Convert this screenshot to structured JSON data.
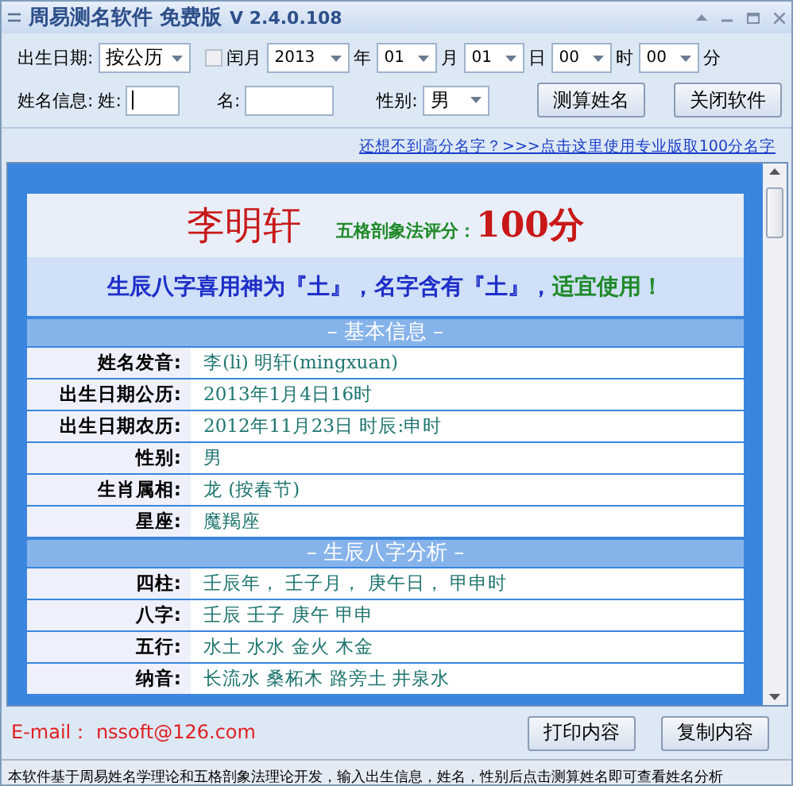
{
  "window": {
    "title": "周易测名软件 免费版",
    "version": "V 2.4.0.108"
  },
  "form": {
    "birth_label": "出生日期:",
    "calendar": "按公历",
    "leap_month": {
      "label": "闰月",
      "checked": false
    },
    "date_parts": [
      {
        "value": "2013",
        "unit": "年"
      },
      {
        "value": "01",
        "unit": "月"
      },
      {
        "value": "01",
        "unit": "日"
      },
      {
        "value": "00",
        "unit": "时"
      },
      {
        "value": "00",
        "unit": "分"
      }
    ],
    "name_label": "姓名信息:",
    "surname_label": "姓:",
    "given_label": "名:",
    "gender_label": "性别:",
    "gender": "男",
    "buttons": [
      "测算姓名",
      "关闭软件"
    ]
  },
  "promo_link": "还想不到高分名字？>>>点击这里使用专业版取100分名字",
  "result": {
    "name": "李明轩",
    "score_label": "五格剖象法评分：",
    "score": "100分",
    "verdict": "生辰八字喜用神为『土』，名字含有『土』，",
    "verdict_note": "适宜使用！",
    "sections": [
      {
        "title": "– 基本信息 –",
        "rows": [
          {
            "label": "姓名发音:",
            "value": "李(li) 明轩(mingxuan)"
          },
          {
            "label": "出生日期公历:",
            "value": "2013年1月4日16时"
          },
          {
            "label": "出生日期农历:",
            "value": "2012年11月23日 时辰:申时"
          },
          {
            "label": "性别:",
            "value": "男"
          },
          {
            "label": "生肖属相:",
            "value": "龙 (按春节)"
          },
          {
            "label": "星座:",
            "value": "魔羯座"
          }
        ]
      },
      {
        "title": "– 生辰八字分析 –",
        "rows": [
          {
            "label": "四柱:",
            "value": "壬辰年， 壬子月， 庚午日， 甲申时"
          },
          {
            "label": "八字:",
            "value": "壬辰 壬子 庚午 甲申"
          },
          {
            "label": "五行:",
            "value": "水土 水水 金火 木金"
          },
          {
            "label": "纳音:",
            "value": "长流水 桑柘木 路旁土 井泉水"
          }
        ]
      }
    ]
  },
  "footer": {
    "email": "E-mail： nssoft@126.com",
    "buttons": [
      "打印内容",
      "复制内容"
    ]
  },
  "status_bar": "本软件基于周易姓名学理论和五格剖象法理论开发，输入出生信息，姓名，性别后点击测算姓名即可查看姓名分析"
}
